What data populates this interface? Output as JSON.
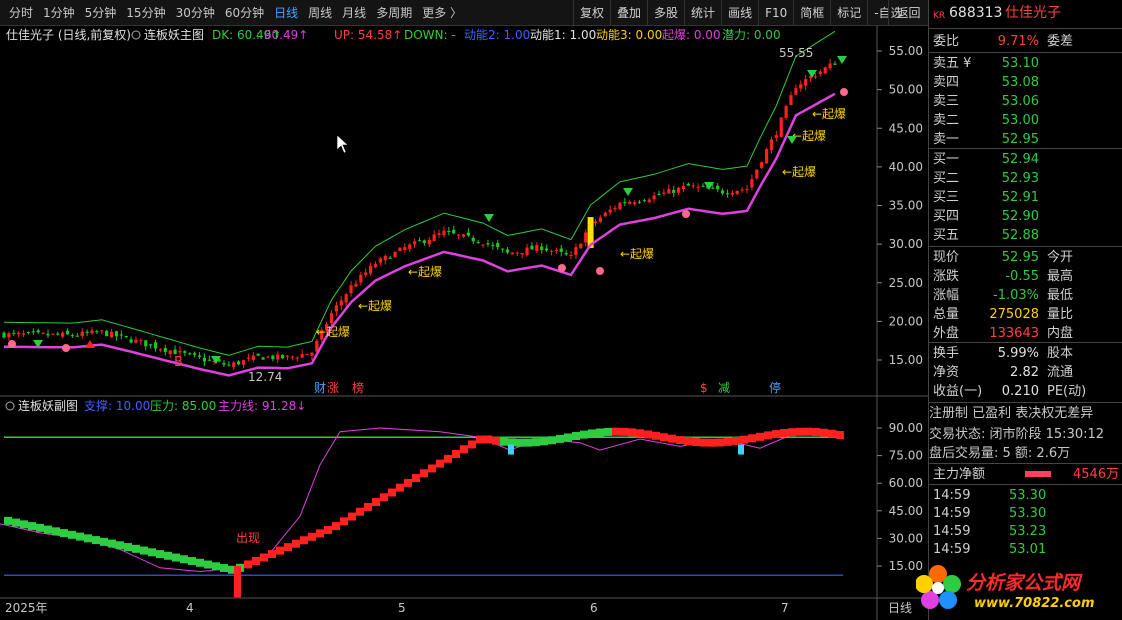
{
  "toolbar": {
    "periods": [
      "分时",
      "1分钟",
      "5分钟",
      "15分钟",
      "30分钟",
      "60分钟",
      "日线",
      "周线",
      "月线",
      "多周期",
      "更多 〉"
    ],
    "active_period": "日线",
    "tools": [
      "复权",
      "叠加",
      "多股",
      "统计",
      "画线",
      "F10",
      "简框",
      "标记",
      "-自选"
    ],
    "back": "返回"
  },
  "main_chart": {
    "stock_title": "仕佳光子 (日线,前复权)",
    "indicator_name": "连板妖主图",
    "legend": [
      {
        "text": "DK: 60.49↑",
        "color": "#2ecc40"
      },
      {
        "text": ": 60.49↑",
        "color": "#e040e0"
      },
      {
        "text": "UP: 54.58↑",
        "color": "#ff4040"
      },
      {
        "text": "DOWN: -",
        "color": "#2ecc40"
      },
      {
        "text": "动能2: 1.00",
        "color": "#4060ff"
      },
      {
        "text": "动能1: 1.00",
        "color": "#e0e0e0"
      },
      {
        "text": "动能3: 0.00",
        "color": "#ffd000"
      },
      {
        "text": "起爆: 0.00",
        "color": "#e040e0"
      },
      {
        "text": "潜力: 0.00",
        "color": "#2ecc40"
      }
    ],
    "price_ticks": [
      "55.00",
      "50.00",
      "45.00",
      "40.00",
      "35.00",
      "30.00",
      "25.00",
      "20.00",
      "15.00"
    ],
    "high_label": "55.55",
    "low_label": "12.74",
    "qibao_label": "←起爆",
    "b_label": "B",
    "bottom_tags": [
      "财",
      "涨",
      "榜",
      "$",
      "减",
      "停"
    ]
  },
  "sub_chart": {
    "indicator_name": "连板妖副图",
    "legend": [
      {
        "text": "支撑: 10.00",
        "color": "#4060ff"
      },
      {
        "text": "压力: 85.00",
        "color": "#2ecc40"
      },
      {
        "text": "主力线: 91.28↓",
        "color": "#e040e0"
      }
    ],
    "ticks": [
      "90.00",
      "75.00",
      "60.00",
      "45.00",
      "30.00",
      "15.00"
    ],
    "event_label": "出现"
  },
  "x_axis": {
    "labels": [
      "2025年",
      "4",
      "5",
      "6",
      "7"
    ],
    "right_label": "日线"
  },
  "quote": {
    "badge": "KR",
    "code": "688313",
    "name": "仕佳光子",
    "weibi_label": "委比",
    "weibi_value": "9.71%",
    "weicha_label": "委差",
    "asks": [
      {
        "label": "卖五 ¥",
        "price": "53.10"
      },
      {
        "label": "卖四",
        "price": "53.08"
      },
      {
        "label": "卖三",
        "price": "53.06"
      },
      {
        "label": "卖二",
        "price": "53.00"
      },
      {
        "label": "卖一",
        "price": "52.95"
      }
    ],
    "bids": [
      {
        "label": "买一",
        "price": "52.94"
      },
      {
        "label": "买二",
        "price": "52.93"
      },
      {
        "label": "买三",
        "price": "52.91"
      },
      {
        "label": "买四",
        "price": "52.90"
      },
      {
        "label": "买五",
        "price": "52.88"
      }
    ],
    "stats": [
      {
        "l1": "现价",
        "v1": "52.95",
        "c1": "green",
        "l2": "今开"
      },
      {
        "l1": "涨跌",
        "v1": "-0.55",
        "c1": "green",
        "l2": "最高"
      },
      {
        "l1": "涨幅",
        "v1": "-1.03%",
        "c1": "green",
        "l2": "最低"
      },
      {
        "l1": "总量",
        "v1": "275028",
        "c1": "yellow",
        "l2": "量比"
      },
      {
        "l1": "外盘",
        "v1": "133643",
        "c1": "red",
        "l2": "内盘"
      }
    ],
    "stats2": [
      {
        "l1": "换手",
        "v1": "5.99%",
        "l2": "股本"
      },
      {
        "l1": "净资",
        "v1": "2.82",
        "l2": "流通"
      },
      {
        "l1": "收益(一)",
        "v1": "0.210",
        "l2": "PE(动)"
      }
    ],
    "reg_line": "注册制 已盈利 表决权无差异",
    "trade_status": "交易状态: 闭市阶段 15:30:12",
    "after_hours": "盘后交易量: 5  额: 2.6万",
    "net_flow_label": "主力净额",
    "net_flow_value": "4546万",
    "ticks": [
      {
        "time": "14:59",
        "price": "53.30"
      },
      {
        "time": "14:59",
        "price": "53.30"
      },
      {
        "time": "14:59",
        "price": "53.23"
      },
      {
        "time": "14:59",
        "price": "53.01"
      },
      {
        "time": "14:59",
        "price": "..."
      }
    ]
  },
  "watermark": {
    "title": "分析家公式网",
    "url": "www.70822.com"
  }
}
